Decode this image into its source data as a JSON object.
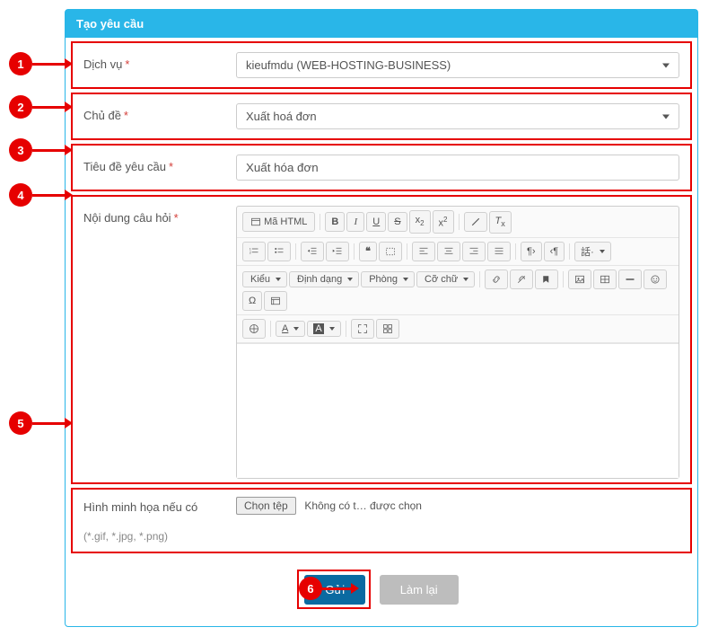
{
  "panel": {
    "title": "Tạo yêu cầu"
  },
  "fields": {
    "service": {
      "label": "Dịch vụ",
      "value": "kieufmdu (WEB-HOSTING-BUSINESS)"
    },
    "topic": {
      "label": "Chủ đề",
      "value": "Xuất hoá đơn"
    },
    "title": {
      "label": "Tiêu đề yêu cầu",
      "value": "Xuất hóa đơn"
    },
    "content": {
      "label": "Nội dung câu hỏi"
    },
    "attach": {
      "label": "Hình minh họa nếu có",
      "hint": "(*.gif, *.jpg, *.png)",
      "button": "Chọn tệp",
      "status": "Không có t… được chọn"
    }
  },
  "editor": {
    "source": "Mã HTML",
    "style": "Kiểu",
    "format": "Định dạng",
    "font": "Phòng",
    "size": "Cỡ chữ"
  },
  "actions": {
    "submit": "Gửi",
    "reset": "Làm lại"
  },
  "callouts": {
    "1": "1",
    "2": "2",
    "3": "3",
    "4": "4",
    "5": "5",
    "6": "6"
  }
}
